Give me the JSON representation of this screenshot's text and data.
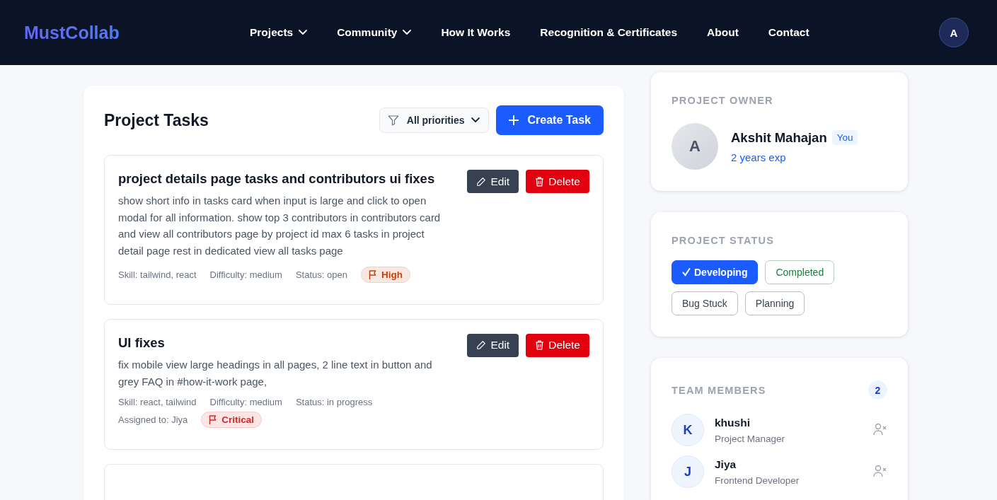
{
  "navbar": {
    "logo": "MustCollab",
    "links": [
      {
        "label": "Projects",
        "dropdown": true
      },
      {
        "label": "Community",
        "dropdown": true
      },
      {
        "label": "How It Works",
        "dropdown": false
      },
      {
        "label": "Recognition & Certificates",
        "dropdown": false
      },
      {
        "label": "About",
        "dropdown": false
      },
      {
        "label": "Contact",
        "dropdown": false
      }
    ],
    "avatar": "A"
  },
  "tasks_panel": {
    "title": "Project Tasks",
    "filter": "All priorities",
    "create_button": "Create Task",
    "tasks": [
      {
        "title": "project details page tasks and contributors ui fixes",
        "description": "show short info in tasks card when input is large and click to open modal for all information. show top 3 contributors in contributors card and view all contributors page by project id max 6 tasks in project detail page rest in dedicated view all tasks page",
        "skill": "Skill: tailwind, react",
        "difficulty": "Difficulty: medium",
        "status": "Status: open",
        "edit_label": "Edit",
        "delete_label": "Delete",
        "priority": {
          "label": "High",
          "color": "#c2410c"
        }
      },
      {
        "title": "UI fixes",
        "description": "fix mobile view large headings in all pages, 2 line text in button and grey FAQ in #how-it-work page,",
        "skill": "Skill: react, tailwind",
        "difficulty": "Difficulty: medium",
        "status": "Status: in progress",
        "assigned_to": "Assigned to: Jiya",
        "edit_label": "Edit",
        "delete_label": "Delete",
        "priority": {
          "label": "Critical",
          "color": "#dc2626"
        }
      }
    ]
  },
  "owner": {
    "heading": "PROJECT OWNER",
    "avatar": "A",
    "name": "Akshit Mahajan",
    "badge": "You",
    "experience": "2 years exp"
  },
  "status": {
    "heading": "PROJECT STATUS",
    "options": [
      {
        "label": "Developing",
        "selected": true,
        "color": "#1a5cff"
      },
      {
        "label": "Completed",
        "selected": false,
        "color": "#15803d"
      },
      {
        "label": "Bug Stuck",
        "selected": false,
        "color": "#374151"
      },
      {
        "label": "Planning",
        "selected": false,
        "color": "#374151"
      }
    ]
  },
  "team": {
    "heading": "TEAM MEMBERS",
    "count": "2",
    "members": [
      {
        "initial": "K",
        "name": "khushi",
        "role": "Project Manager"
      },
      {
        "initial": "J",
        "name": "Jiya",
        "role": "Frontend Developer"
      }
    ]
  }
}
